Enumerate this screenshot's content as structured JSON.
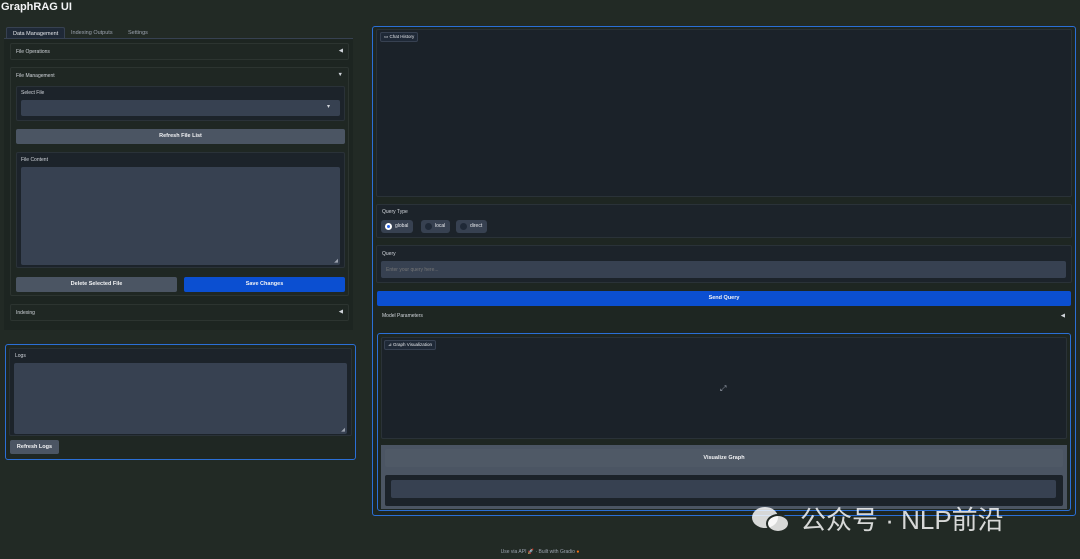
{
  "app": {
    "title": "GraphRAG UI"
  },
  "tabs": [
    {
      "label": "Data Management",
      "active": true
    },
    {
      "label": "Indexing Outputs",
      "active": false
    },
    {
      "label": "Settings",
      "active": false
    }
  ],
  "file_operations": {
    "label": "File Operations",
    "state": "collapsed"
  },
  "file_management": {
    "label": "File Management",
    "select_file_label": "Select File",
    "select_value": "",
    "refresh_button": "Refresh File List",
    "file_content_label": "File Content",
    "file_content_value": "",
    "delete_button": "Delete Selected File",
    "save_button": "Save Changes"
  },
  "indexing": {
    "label": "Indexing",
    "state": "collapsed"
  },
  "logs": {
    "label": "Logs",
    "value": "",
    "refresh_button": "Refresh Logs"
  },
  "chat": {
    "history_label": "Chat History"
  },
  "query_type": {
    "label": "Query Type",
    "options": [
      "global",
      "local",
      "direct"
    ],
    "selected": "global"
  },
  "query": {
    "label": "Query",
    "placeholder": "Enter your query here...",
    "send_button": "Send Query"
  },
  "model_parameters": {
    "label": "Model Parameters",
    "state": "collapsed"
  },
  "graph": {
    "label": "Graph Visualization",
    "visualize_button": "Visualize Graph",
    "output_value": ""
  },
  "watermark": {
    "text": "公众号 · NLP前沿"
  },
  "footer": {
    "api_link": "Use via API",
    "built_with": "Built with Gradio"
  },
  "colors": {
    "primary": "#0b4fd1",
    "focus_border": "#2b6fd6",
    "background": "#222a25"
  }
}
